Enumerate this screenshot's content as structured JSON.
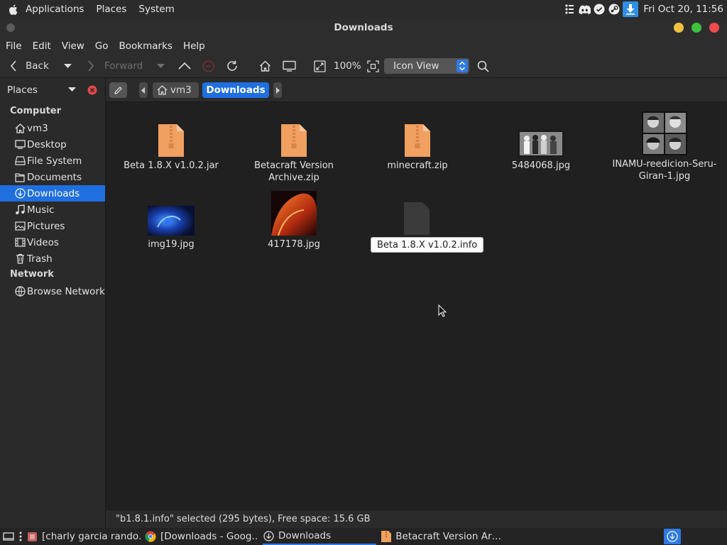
{
  "top_panel": {
    "menus": [
      "Applications",
      "Places",
      "System"
    ],
    "clock": "Fri Oct 20, 11:56"
  },
  "window": {
    "title": "Downloads"
  },
  "menubar": [
    "File",
    "Edit",
    "View",
    "Go",
    "Bookmarks",
    "Help"
  ],
  "toolbar": {
    "back_label": "Back",
    "forward_label": "Forward",
    "zoom": "100%",
    "view_mode": "Icon View"
  },
  "sidebar": {
    "header": "Places",
    "sections": [
      {
        "title": "Computer",
        "items": [
          {
            "label": "vm3",
            "icon": "home-icon"
          },
          {
            "label": "Desktop",
            "icon": "desktop-icon"
          },
          {
            "label": "File System",
            "icon": "drive-icon"
          },
          {
            "label": "Documents",
            "icon": "document-icon"
          },
          {
            "label": "Downloads",
            "icon": "download-icon",
            "active": true
          },
          {
            "label": "Music",
            "icon": "music-icon"
          },
          {
            "label": "Pictures",
            "icon": "picture-icon"
          },
          {
            "label": "Videos",
            "icon": "video-icon"
          },
          {
            "label": "Trash",
            "icon": "trash-icon"
          }
        ]
      },
      {
        "title": "Network",
        "items": [
          {
            "label": "Browse Network",
            "icon": "network-icon"
          }
        ]
      }
    ]
  },
  "pathbar": {
    "crumbs": [
      "vm3",
      "Downloads"
    ]
  },
  "files": [
    {
      "name": "Beta 1.8.X v1.0.2.jar",
      "type": "archive"
    },
    {
      "name": "Betacraft Version Archive.zip",
      "type": "archive"
    },
    {
      "name": "minecraft.zip",
      "type": "archive"
    },
    {
      "name": "5484068.jpg",
      "type": "image"
    },
    {
      "name": "INAMU-reedicion-Seru-Giran-1.jpg",
      "type": "image"
    },
    {
      "name": "img19.jpg",
      "type": "image"
    },
    {
      "name": "417178.jpg",
      "type": "image"
    }
  ],
  "tooltip": "Beta 1.8.X v1.0.2.info",
  "status": "\"b1.8.1.info\" selected (295 bytes), Free space: 15.6 GB",
  "taskbar": {
    "tasks": [
      {
        "label": "[charly garcia rando…",
        "icon": "app-icon"
      },
      {
        "label": "[Downloads - Goog…",
        "icon": "chrome-icon"
      },
      {
        "label": "Downloads",
        "icon": "download-icon",
        "active": true
      },
      {
        "label": "Betacraft Version Ar…",
        "icon": "archive-icon"
      }
    ]
  },
  "colors": {
    "accent": "#1f6fe0",
    "archive": "#f0a060",
    "close": "#f04a4a",
    "minimize": "#f0c040",
    "maximize": "#40c040"
  }
}
